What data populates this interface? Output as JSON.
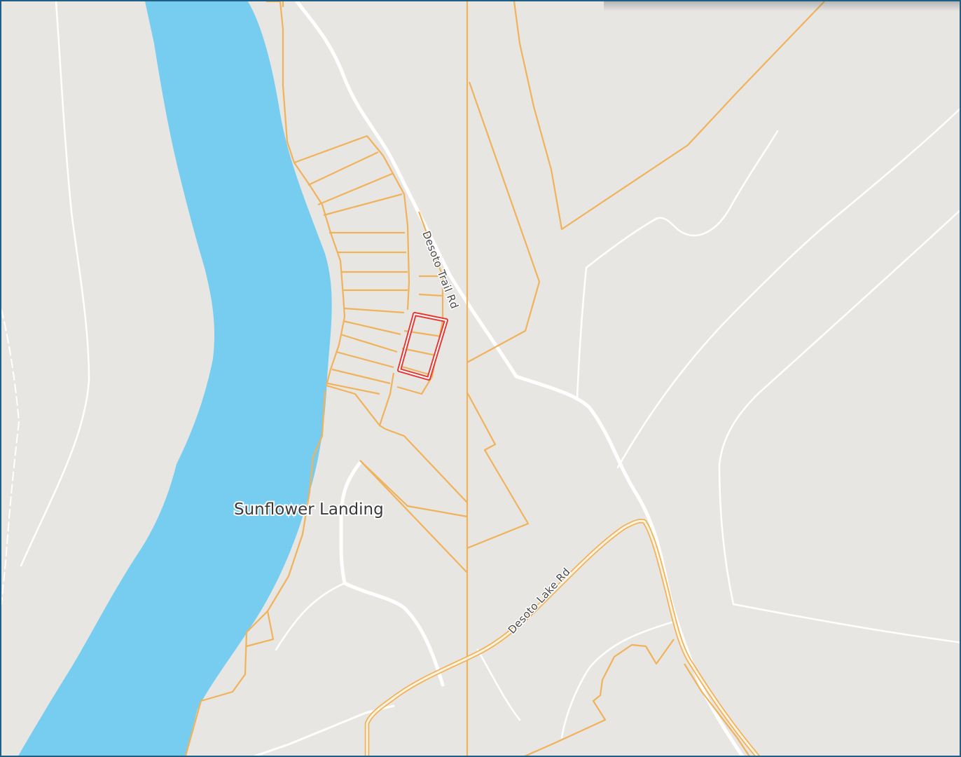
{
  "map": {
    "place_label": "Sunflower Landing",
    "road_labels": {
      "desoto_trail": "Desoto Trail Rd",
      "desoto_lake": "Desoto Lake Rd"
    },
    "colors": {
      "land": "#e8e6e2",
      "water": "#76cdf0",
      "parcel_line": "#f0b25a",
      "road": "#ffffff",
      "highlight_parcel": "#e53935",
      "frame_border": "#1f5f86"
    }
  }
}
